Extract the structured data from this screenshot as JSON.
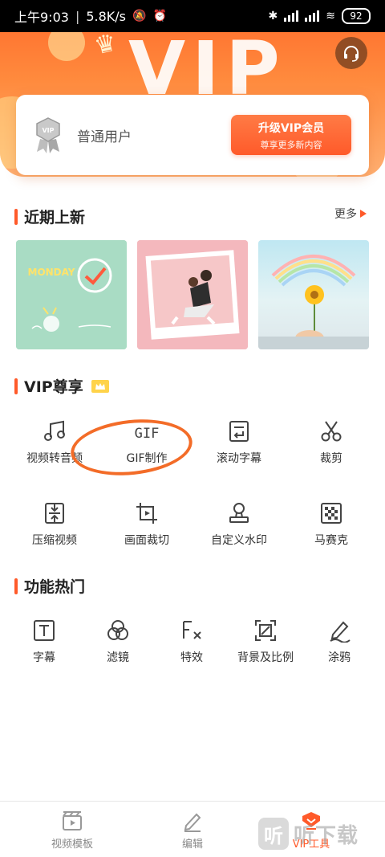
{
  "status_bar": {
    "time": "上午9:03",
    "speed": "5.8K/s",
    "battery": "92"
  },
  "header": {
    "banner_text": "VIP",
    "user": {
      "name": "普通用户",
      "badge_text": "VIP"
    },
    "upgrade": {
      "title": "升级VIP会员",
      "subtitle": "尊享更多新内容"
    }
  },
  "recent": {
    "title": "近期上新",
    "more": "更多",
    "thumbs": [
      {
        "label": "MONDAY"
      },
      {
        "label": ""
      },
      {
        "label": ""
      }
    ]
  },
  "vip": {
    "title": "VIP尊享",
    "items": [
      {
        "label": "视频转音频",
        "icon": "music-note-icon"
      },
      {
        "label": "GIF制作",
        "icon": "gif-icon"
      },
      {
        "label": "滚动字幕",
        "icon": "scroll-subtitle-icon"
      },
      {
        "label": "裁剪",
        "icon": "scissors-icon"
      },
      {
        "label": "压缩视频",
        "icon": "compress-icon"
      },
      {
        "label": "画面裁切",
        "icon": "crop-icon"
      },
      {
        "label": "自定义水印",
        "icon": "stamp-icon"
      },
      {
        "label": "马赛克",
        "icon": "mosaic-icon"
      }
    ]
  },
  "hot": {
    "title": "功能热门",
    "items": [
      {
        "label": "字幕",
        "icon": "text-icon"
      },
      {
        "label": "滤镜",
        "icon": "filter-icon"
      },
      {
        "label": "特效",
        "icon": "fx-icon"
      },
      {
        "label": "背景及比例",
        "icon": "ratio-icon"
      },
      {
        "label": "涂鸦",
        "icon": "brush-icon"
      }
    ]
  },
  "nav": {
    "items": [
      {
        "label": "视频模板",
        "icon": "film-icon",
        "active": false
      },
      {
        "label": "编辑",
        "icon": "edit-icon",
        "active": false
      },
      {
        "label": "VIP工具",
        "icon": "vip-tool-icon",
        "active": true
      }
    ]
  },
  "watermark": {
    "logo": "听",
    "text": "听下载"
  },
  "colors": {
    "accent": "#ff5a2a",
    "header_top": "#ff6a2b",
    "header_bottom": "#ffb072",
    "annotation": "#f36c28"
  }
}
